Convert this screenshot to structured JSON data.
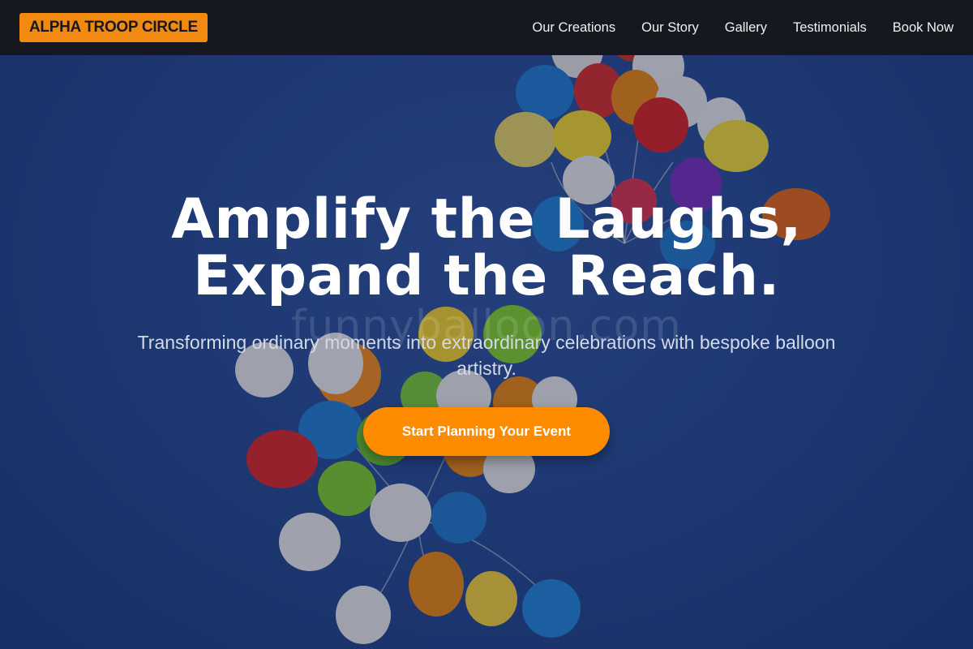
{
  "brand": {
    "name": "ALPHA TROOP CIRCLE"
  },
  "nav": {
    "items": [
      {
        "label": "Our Creations"
      },
      {
        "label": "Our Story"
      },
      {
        "label": "Gallery"
      },
      {
        "label": "Testimonials"
      },
      {
        "label": "Book Now"
      }
    ]
  },
  "hero": {
    "headline_line1": "Amplify the Laughs,",
    "headline_line2": "Expand the Reach.",
    "subtitle": "Transforming ordinary moments into extraordinary celebrations with bespoke balloon artistry.",
    "cta_label": "Start Planning Your Event",
    "watermark": "funnyballoon.com"
  },
  "colors": {
    "accent": "#ff8c00",
    "logo_bg": "#f28a12",
    "navbar_bg": "#15181e",
    "sky": "#244a98"
  }
}
